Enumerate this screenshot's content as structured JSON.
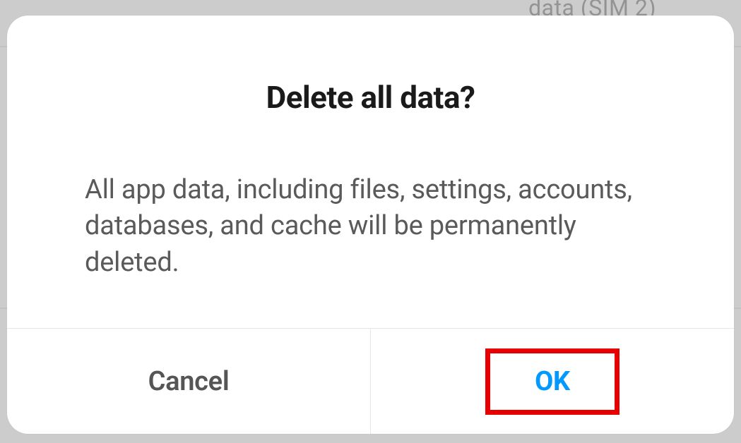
{
  "background": {
    "partial_text": "data (SIM 2)"
  },
  "dialog": {
    "title": "Delete all data?",
    "body": "All app data, including files, settings, accounts, databases, and cache will be permanently deleted.",
    "actions": {
      "cancel_label": "Cancel",
      "ok_label": "OK"
    }
  }
}
